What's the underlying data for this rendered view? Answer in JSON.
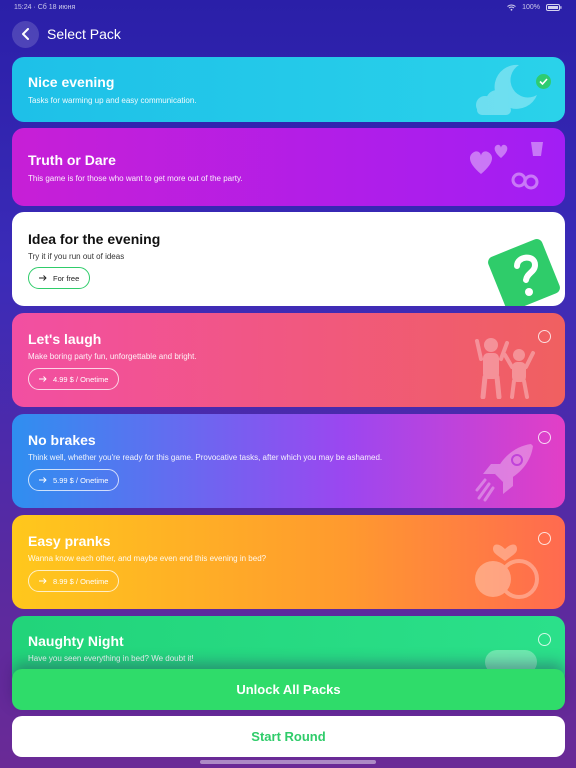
{
  "status": {
    "left": "15:24 · Сб 18 июня",
    "right": "100%"
  },
  "header": {
    "title": "Select Pack"
  },
  "packs": [
    {
      "title": "Nice evening",
      "desc": "Tasks for warming up and easy communication.",
      "selected": true
    },
    {
      "title": "Truth or Dare",
      "desc": "This game is for those who want to get more out of the party."
    },
    {
      "title": "Idea for the evening",
      "desc": "Try it if you run out of ideas",
      "price": "For free"
    },
    {
      "title": "Let's laugh",
      "desc": "Make boring party fun, unforgettable and bright.",
      "price": "4.99 $ / Onetime"
    },
    {
      "title": "No brakes",
      "desc": "Think well, whether you're ready for this game. Provocative tasks, after which you may be ashamed.",
      "price": "5.99 $ / Onetime"
    },
    {
      "title": "Easy pranks",
      "desc": "Wanna know each other, and maybe even end this evening in bed?",
      "price": "8.99 $ / Onetime"
    },
    {
      "title": "Naughty Night",
      "desc": "Have you seen everything in bed? We doubt it!"
    }
  ],
  "buttons": {
    "unlock": "Unlock All Packs",
    "start": "Start Round"
  },
  "colors": {
    "accent_green": "#2fdc6a",
    "background_top": "#2a1fa8",
    "background_bottom": "#6a2a96"
  }
}
